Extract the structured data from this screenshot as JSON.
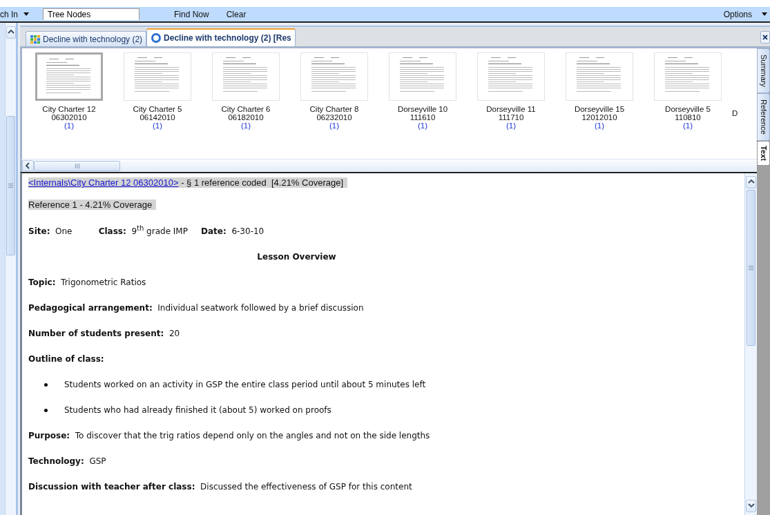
{
  "toolbar": {
    "search_in": "ch In",
    "field_value": "Tree Nodes",
    "buttons": [
      "Find Now",
      "Clear"
    ],
    "options": "Options"
  },
  "tabs": [
    {
      "label": "Decline with technology (2)",
      "selected": false,
      "kind": "node"
    },
    {
      "label": "Decline with technology (2) [Res",
      "selected": true,
      "kind": "result"
    }
  ],
  "thumbnails": [
    {
      "name": "City Charter 12",
      "date": "06302010",
      "count": "(1)",
      "selected": true
    },
    {
      "name": "City Charter 5",
      "date": "06142010",
      "count": "(1)",
      "selected": false
    },
    {
      "name": "City Charter 6",
      "date": "06182010",
      "count": "(1)",
      "selected": false
    },
    {
      "name": "City Charter 8",
      "date": "06232010",
      "count": "(1)",
      "selected": false
    },
    {
      "name": "Dorseyville 10",
      "date": "111610",
      "count": "(1)",
      "selected": false
    },
    {
      "name": "Dorseyville 11",
      "date": "111710",
      "count": "(1)",
      "selected": false
    },
    {
      "name": "Dorseyville 15",
      "date": "12012010",
      "count": "(1)",
      "selected": false
    },
    {
      "name": "Dorseyville 5",
      "date": "110810",
      "count": "(1)",
      "selected": false
    },
    {
      "name": "D",
      "selected": false
    }
  ],
  "side_tabs": [
    {
      "label": "Summary",
      "selected": false
    },
    {
      "label": "Reference",
      "selected": false
    },
    {
      "label": "Text",
      "selected": true
    }
  ],
  "document": {
    "link": "<Internals\\City Charter 12 06302010>",
    "header": "- § 1 reference coded  [4.21% Coverage]",
    "reference": "Reference 1 - 4.21% Coverage",
    "paragraphs": [
      {
        "kind": "text",
        "text": "**Site:**  One          **Class:**  9$^{th}$ grade IMP     **Date:**  6-30-10"
      },
      {
        "kind": "heading",
        "text": "Lesson Overview"
      },
      {
        "kind": "text",
        "text": "**Topic:**  Trigonometric Ratios"
      },
      {
        "kind": "text",
        "text": "**Pedagogical arrangement:**  Individual seatwork followed by a brief discussion"
      },
      {
        "kind": "text",
        "text": "**Number of students present:**  20"
      },
      {
        "kind": "text",
        "text": "**Outline of class:**"
      },
      {
        "kind": "bullet",
        "text": "Students worked on an activity in GSP the entire class period until about 5 minutes left"
      },
      {
        "kind": "bullet",
        "text": "Students who had already finished it (about 5) worked on proofs"
      },
      {
        "kind": "text",
        "text": "**Purpose:**  To discover that the trig ratios depend only on the angles and not on the side lengths"
      },
      {
        "kind": "text",
        "text": "**Technology:**  GSP"
      },
      {
        "kind": "text",
        "text": "**Discussion with teacher after class:**  Discussed the effectiveness of GSP for this content"
      }
    ]
  }
}
